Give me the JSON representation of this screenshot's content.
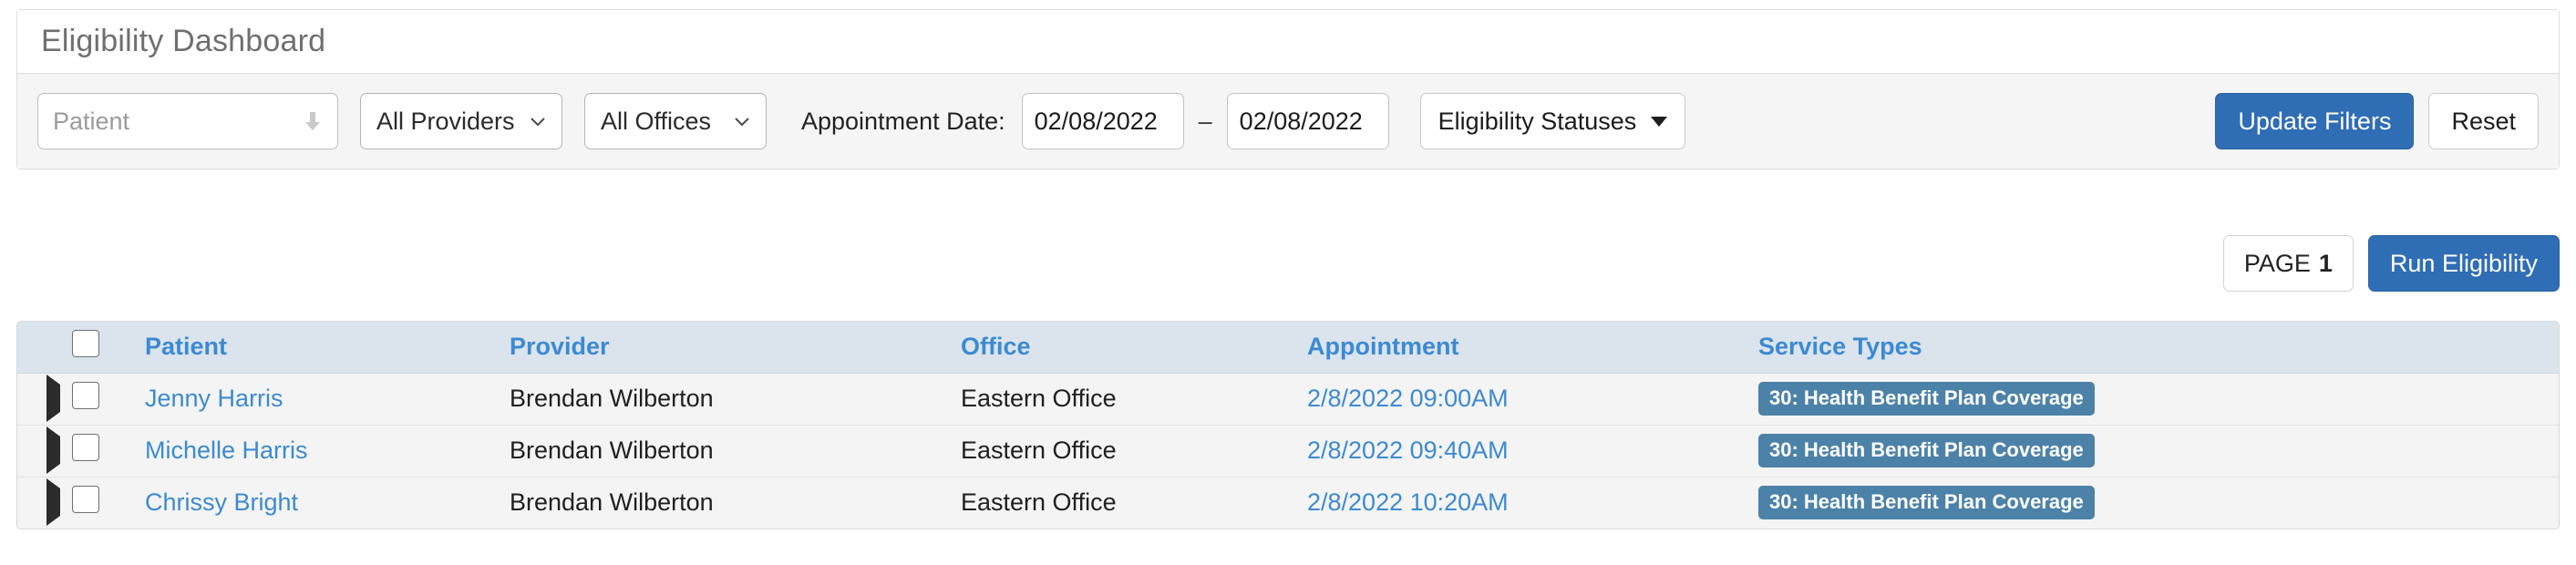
{
  "card": {
    "title": "Eligibility Dashboard"
  },
  "filters": {
    "patient": {
      "placeholder": "Patient",
      "value": "",
      "icon": "download-arrow-icon"
    },
    "providers": {
      "selected": "All Providers",
      "options": [
        "All Providers"
      ]
    },
    "offices": {
      "selected": "All Offices",
      "options": [
        "All Offices"
      ]
    },
    "appointment_date": {
      "label": "Appointment Date:",
      "from": "02/08/2022",
      "separator": "–",
      "to": "02/08/2022"
    },
    "statuses": {
      "label": "Eligibility Statuses",
      "icon": "caret-down-icon"
    },
    "update_filters_label": "Update Filters",
    "reset_label": "Reset"
  },
  "toolbar": {
    "page_label": "PAGE",
    "page_number": "1",
    "run_eligibility_label": "Run Eligibility"
  },
  "table": {
    "columns": [
      {
        "key": "caret",
        "label": ""
      },
      {
        "key": "check",
        "label": ""
      },
      {
        "key": "patient",
        "label": "Patient"
      },
      {
        "key": "provider",
        "label": "Provider"
      },
      {
        "key": "office",
        "label": "Office"
      },
      {
        "key": "appointment",
        "label": "Appointment"
      },
      {
        "key": "service_types",
        "label": "Service Types"
      }
    ],
    "rows": [
      {
        "patient": "Jenny Harris",
        "provider": "Brendan Wilberton",
        "office": "Eastern Office",
        "appointment": "2/8/2022 09:00AM",
        "service_types": "30: Health Benefit Plan Coverage"
      },
      {
        "patient": "Michelle Harris",
        "provider": "Brendan Wilberton",
        "office": "Eastern Office",
        "appointment": "2/8/2022 09:40AM",
        "service_types": "30: Health Benefit Plan Coverage"
      },
      {
        "patient": "Chrissy Bright",
        "provider": "Brendan Wilberton",
        "office": "Eastern Office",
        "appointment": "2/8/2022 10:20AM",
        "service_types": "30: Health Benefit Plan Coverage"
      }
    ]
  },
  "colors": {
    "primary_button": "#2f6db5",
    "link": "#3c8ad2",
    "table_header_bg": "#dbe4ed",
    "row_bg": "#f4f4f4",
    "badge_bg": "#4c82a8",
    "filter_bar_bg": "#f5f5f5"
  }
}
